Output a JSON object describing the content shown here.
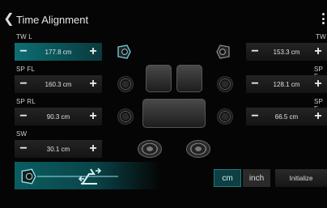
{
  "header": {
    "title": "Time Alignment",
    "back_icon": "chevron-left-icon",
    "menu_icon": "vertical-dots-icon"
  },
  "channels": [
    {
      "key": "tw_l",
      "label": "TW L",
      "value": "177.8 cm",
      "selected": true
    },
    {
      "key": "tw_r",
      "label": "TW",
      "value": "153.3 cm",
      "selected": false
    },
    {
      "key": "sp_fl",
      "label": "SP FL",
      "value": "160.3 cm",
      "selected": false
    },
    {
      "key": "sp_fr",
      "label": "SP F",
      "value": "128.1 cm",
      "selected": false
    },
    {
      "key": "sp_rl",
      "label": "SP RL",
      "value": "90.3 cm",
      "selected": false
    },
    {
      "key": "sp_rr",
      "label": "SP F",
      "value": "66.5 cm",
      "selected": false
    },
    {
      "key": "sw",
      "label": "SW",
      "value": "30.1 cm",
      "selected": false
    }
  ],
  "controls": {
    "minus_symbol": "−",
    "plus_symbol": "+"
  },
  "units": {
    "cm_label": "cm",
    "inch_label": "inch",
    "active": "cm"
  },
  "initialize_label": "Initialize",
  "listening_position": {
    "icons": [
      "tweeter-icon",
      "seat-position-icon"
    ]
  },
  "colors": {
    "accent": "#0b6c70",
    "background": "#050505",
    "control_bg": "#1e1e1e"
  }
}
